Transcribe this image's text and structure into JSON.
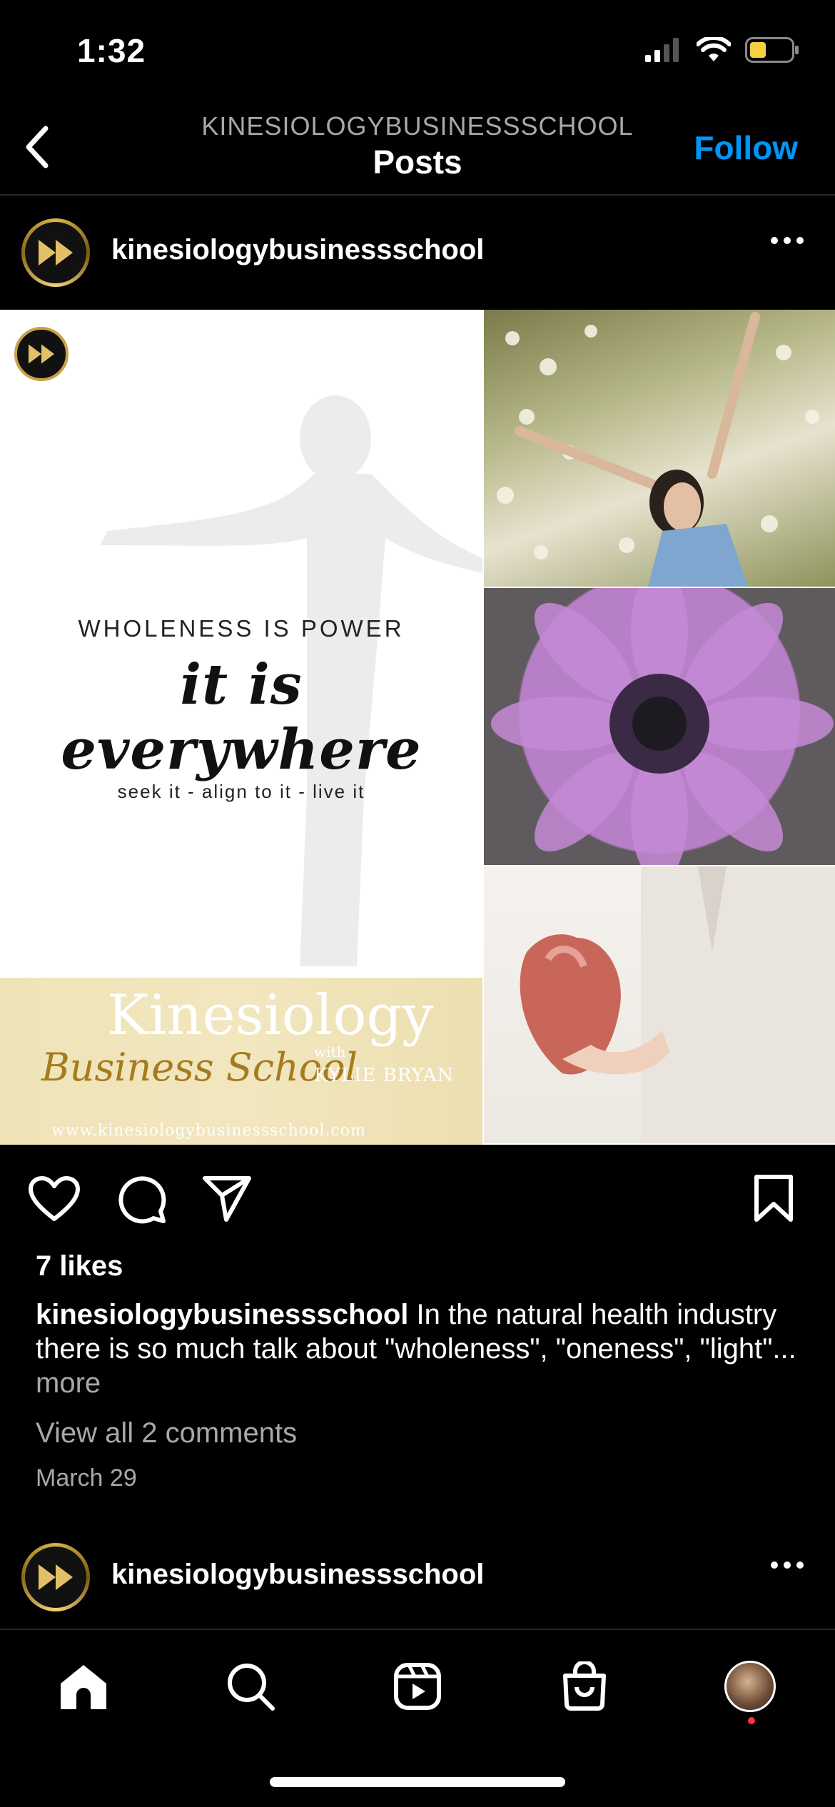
{
  "status_bar": {
    "time": "1:32",
    "battery_color": "#f5d142"
  },
  "nav": {
    "subtitle": "KINESIOLOGYBUSINESSSCHOOL",
    "title": "Posts",
    "follow_label": "Follow"
  },
  "post": {
    "username": "kinesiologybusinessschool",
    "image": {
      "headline": "WHOLENESS IS POWER",
      "script_line": "it is everywhere",
      "subline": "seek it - align to it - live it",
      "brand_kin": "Kinesiology",
      "brand_bus": "Business School",
      "brand_with": "with",
      "brand_name": "KYLIE BRYAN",
      "brand_url": "www.kinesiologybusinessschool.com"
    },
    "likes": "7 likes",
    "caption_user": "kinesiologybusinessschool",
    "caption_text": " In the natural health industry there is so much talk about \"wholeness\", \"oneness\", \"light\"... ",
    "caption_more": "more",
    "view_comments": "View all 2 comments",
    "date": "March 29"
  },
  "next_post": {
    "username": "kinesiologybusinessschool"
  },
  "tab_bar": {
    "icons": [
      "home-icon",
      "search-icon",
      "reels-icon",
      "shop-icon",
      "profile-avatar"
    ]
  },
  "colors": {
    "accent": "#0095f6",
    "muted": "#a8a8a8",
    "background": "#000000",
    "gold": "#c9a245"
  }
}
